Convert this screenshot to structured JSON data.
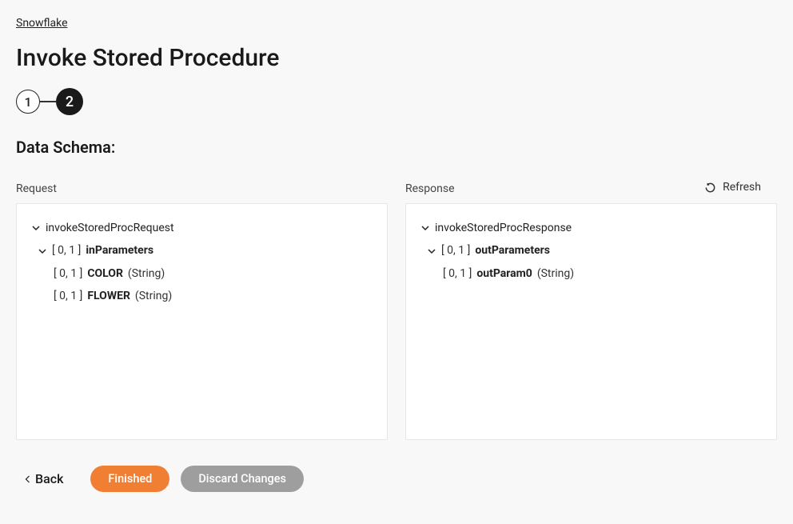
{
  "breadcrumb": "Snowflake",
  "title": "Invoke Stored Procedure",
  "steps": {
    "step1": "1",
    "step2": "2"
  },
  "sectionTitle": "Data Schema:",
  "refreshLabel": "Refresh",
  "request": {
    "label": "Request",
    "root": "invokeStoredProcRequest",
    "paramsCard": "[ 0, 1 ]",
    "paramsName": "inParameters",
    "items": [
      {
        "card": "[ 0, 1 ]",
        "name": "COLOR",
        "type": "(String)"
      },
      {
        "card": "[ 0, 1 ]",
        "name": "FLOWER",
        "type": "(String)"
      }
    ]
  },
  "response": {
    "label": "Response",
    "root": "invokeStoredProcResponse",
    "paramsCard": "[ 0, 1 ]",
    "paramsName": "outParameters",
    "items": [
      {
        "card": "[ 0, 1 ]",
        "name": "outParam0",
        "type": "(String)"
      }
    ]
  },
  "footer": {
    "back": "Back",
    "finished": "Finished",
    "discard": "Discard Changes"
  }
}
